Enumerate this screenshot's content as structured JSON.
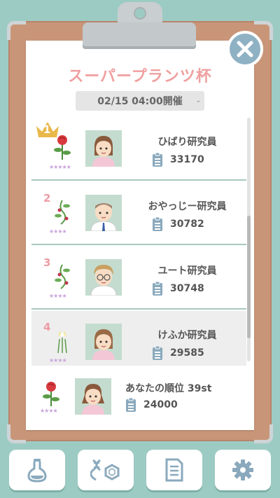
{
  "title": "スーパープランツ杯",
  "date_select": {
    "value": "02/15 04:00開催"
  },
  "entries": [
    {
      "rank": "1",
      "name": "ひばり研究員",
      "score": "33170",
      "flower": "rose"
    },
    {
      "rank": "2",
      "name": "おやっじー研究員",
      "score": "30782",
      "flower": "pea"
    },
    {
      "rank": "3",
      "name": "ユート研究員",
      "score": "30748",
      "flower": "pea"
    },
    {
      "rank": "4",
      "name": "けふか研究員",
      "score": "29585",
      "flower": "lily"
    }
  ],
  "my_rank": {
    "label": "あなたの順位 39st",
    "score": "24000",
    "flower": "rose"
  },
  "stars": {
    "five": "★★★★★",
    "four": "★★★★"
  },
  "toolbar": {
    "items": [
      {
        "icon": "flask-icon"
      },
      {
        "icon": "dna-molecule-icon"
      },
      {
        "icon": "document-icon"
      },
      {
        "icon": "gear-icon"
      }
    ]
  },
  "colors": {
    "accent": "#f0a0a0",
    "board": "#c99578",
    "background": "#9ccbc3",
    "button": "#8fb1c4"
  }
}
